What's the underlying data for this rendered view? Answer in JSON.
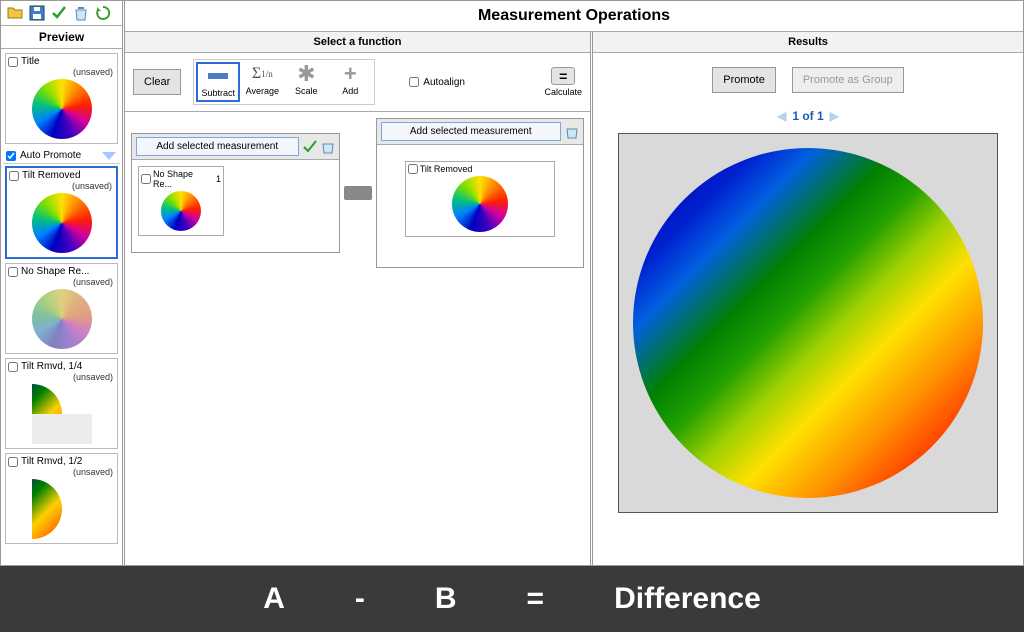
{
  "app": {
    "title": "Measurement Operations"
  },
  "toolbar": {
    "icons": [
      "folder-open-icon",
      "save-icon",
      "check-icon",
      "trash-icon",
      "refresh-icon"
    ]
  },
  "preview": {
    "title": "Preview",
    "auto_promote_label": "Auto Promote",
    "auto_promote_checked": true,
    "items": [
      {
        "title": "Title",
        "subtitle": "(unsaved)",
        "checked": false,
        "thumb": "grad",
        "mask": "none",
        "selected": false
      },
      {
        "title": "Tilt Removed",
        "subtitle": "(unsaved)",
        "checked": false,
        "thumb": "grad",
        "mask": "none",
        "selected": true
      },
      {
        "title": "No Shape Re...",
        "subtitle": "(unsaved)",
        "checked": false,
        "thumb": "soft",
        "mask": "none",
        "selected": false
      },
      {
        "title": "Tilt Rmvd, 1/4",
        "subtitle": "(unsaved)",
        "checked": false,
        "thumb": "lin",
        "mask": "quarter",
        "selected": false
      },
      {
        "title": "Tilt Rmvd, 1/2",
        "subtitle": "(unsaved)",
        "checked": false,
        "thumb": "lin",
        "mask": "half",
        "selected": false
      }
    ]
  },
  "functions": {
    "section_title": "Select a function",
    "clear_label": "Clear",
    "ops": [
      {
        "key": "subtract",
        "label": "Subtract",
        "active": true
      },
      {
        "key": "average",
        "label": "Average",
        "active": false
      },
      {
        "key": "scale",
        "label": "Scale",
        "active": false
      },
      {
        "key": "add",
        "label": "Add",
        "active": false
      }
    ],
    "autoalign_label": "Autoalign",
    "autoalign_checked": false,
    "calculate_label": "Calculate",
    "add_selected_label": "Add selected measurement",
    "operand_a": {
      "items": [
        {
          "title": "No Shape Re...",
          "count": "1"
        }
      ]
    },
    "operand_b": {
      "item": {
        "title": "Tilt Removed"
      }
    }
  },
  "results": {
    "section_title": "Results",
    "promote_label": "Promote",
    "promote_group_label": "Promote as Group",
    "pager_text": "1 of 1"
  },
  "footer": {
    "a": "A",
    "minus": "-",
    "b": "B",
    "eq": "=",
    "diff": "Difference"
  }
}
